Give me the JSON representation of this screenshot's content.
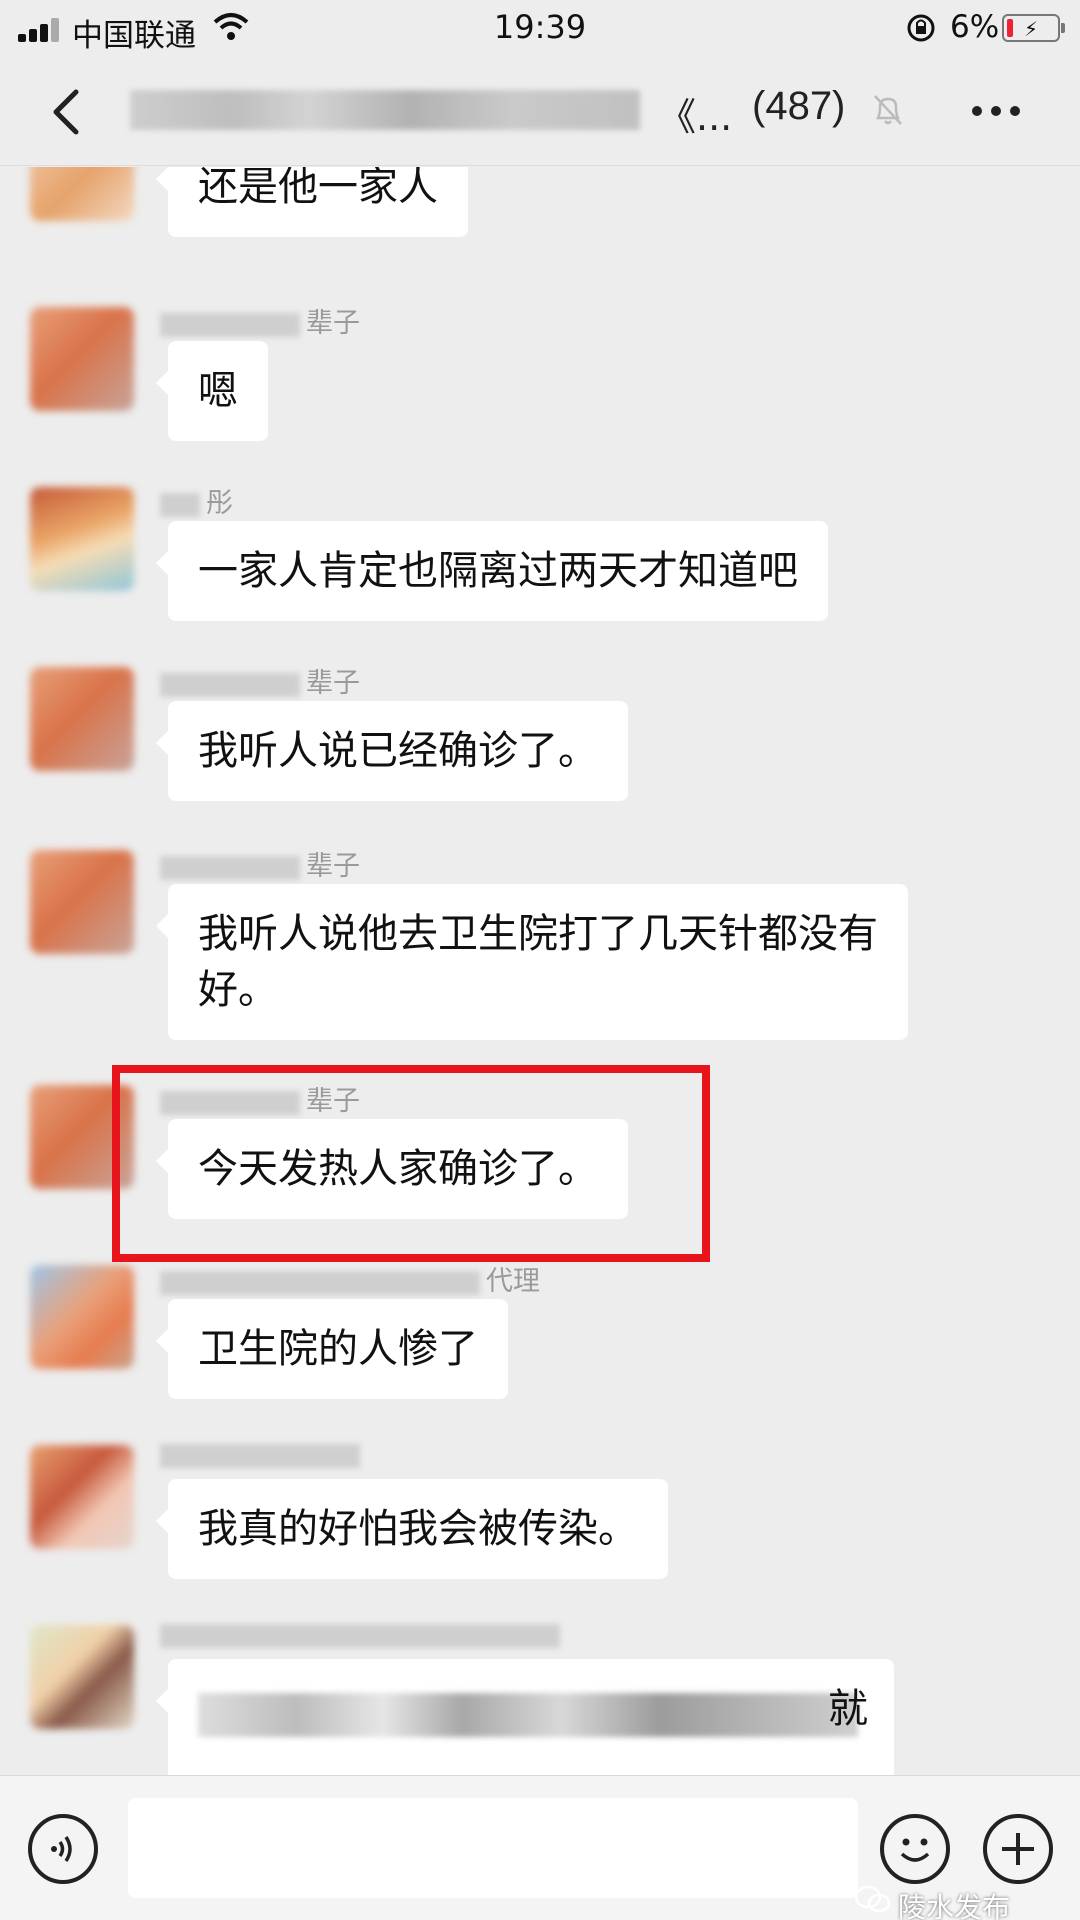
{
  "status_bar": {
    "carrier": "中国联通",
    "time": "19:39",
    "battery_percent": "6%"
  },
  "nav": {
    "title_suffix": "《...",
    "member_count": "(487)"
  },
  "messages": [
    {
      "sender": "",
      "text": "还是他一家人"
    },
    {
      "sender": "辈子",
      "text": "嗯"
    },
    {
      "sender": "彤",
      "text": "一家人肯定也隔离过两天才知道吧"
    },
    {
      "sender": "辈子",
      "text": "我听人说已经确诊了。"
    },
    {
      "sender": "辈子",
      "text": "我听人说他去卫生院打了几天针都没有好。"
    },
    {
      "sender": "辈子",
      "text": "今天发热人家确诊了。"
    },
    {
      "sender": "代理",
      "text": "卫生院的人惨了"
    },
    {
      "sender": "",
      "text": "我真的好怕我会被传染。"
    },
    {
      "sender": "",
      "text": "就"
    }
  ],
  "watermark": "陵水发布",
  "colors": {
    "background": "#ededed",
    "bubble": "#ffffff",
    "highlight_border": "#e8141b"
  },
  "icons": [
    "signal-icon",
    "wifi-icon",
    "rotation-lock-icon",
    "battery-icon",
    "back-icon",
    "mute-bell-icon",
    "more-icon",
    "voice-icon",
    "emoji-icon",
    "plus-icon"
  ]
}
